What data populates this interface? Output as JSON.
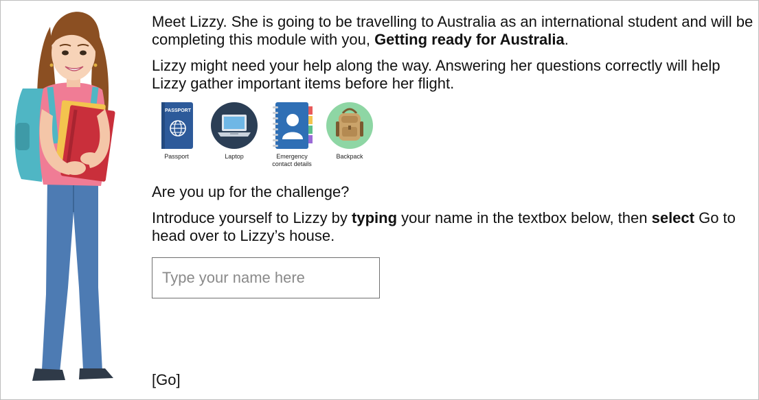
{
  "intro": {
    "p1_a": "Meet Lizzy. She is going to be travelling to Australia as an international student and will be completing this module with you, ",
    "p1_bold": "Getting ready for Australia",
    "p1_end": ".",
    "p2": "Lizzy might need your help along the way. Answering her questions correctly will help Lizzy gather important items before her flight."
  },
  "items": [
    {
      "label": "Passport",
      "icon": "passport-icon",
      "cover_text": "PASSPORT"
    },
    {
      "label": "Laptop",
      "icon": "laptop-icon"
    },
    {
      "label": "Emergency contact details",
      "icon": "contact-book-icon"
    },
    {
      "label": "Backpack",
      "icon": "backpack-icon"
    }
  ],
  "challenge": "Are you up for the challenge?",
  "instructions": {
    "a": "Introduce yourself to Lizzy by ",
    "typing": "typing",
    "b": " your name in the textbox below, then ",
    "select": "select",
    "c": " Go to head over to Lizzy’s house."
  },
  "name_input": {
    "placeholder": "Type your name here",
    "value": ""
  },
  "go_label": "[Go]",
  "colors": {
    "passport": "#2d5a9a",
    "laptop_bg": "#2b3e55",
    "contact_book": "#2f6fb5",
    "backpack_bg": "#8ed6a4",
    "backpack": "#caa36a",
    "shirt": "#f07c95",
    "jeans": "#4d7bb3",
    "hair": "#8b4f22",
    "backpack_strap": "#4fb6c4",
    "book_red": "#c92f3b",
    "book_yellow": "#f3c44e"
  }
}
